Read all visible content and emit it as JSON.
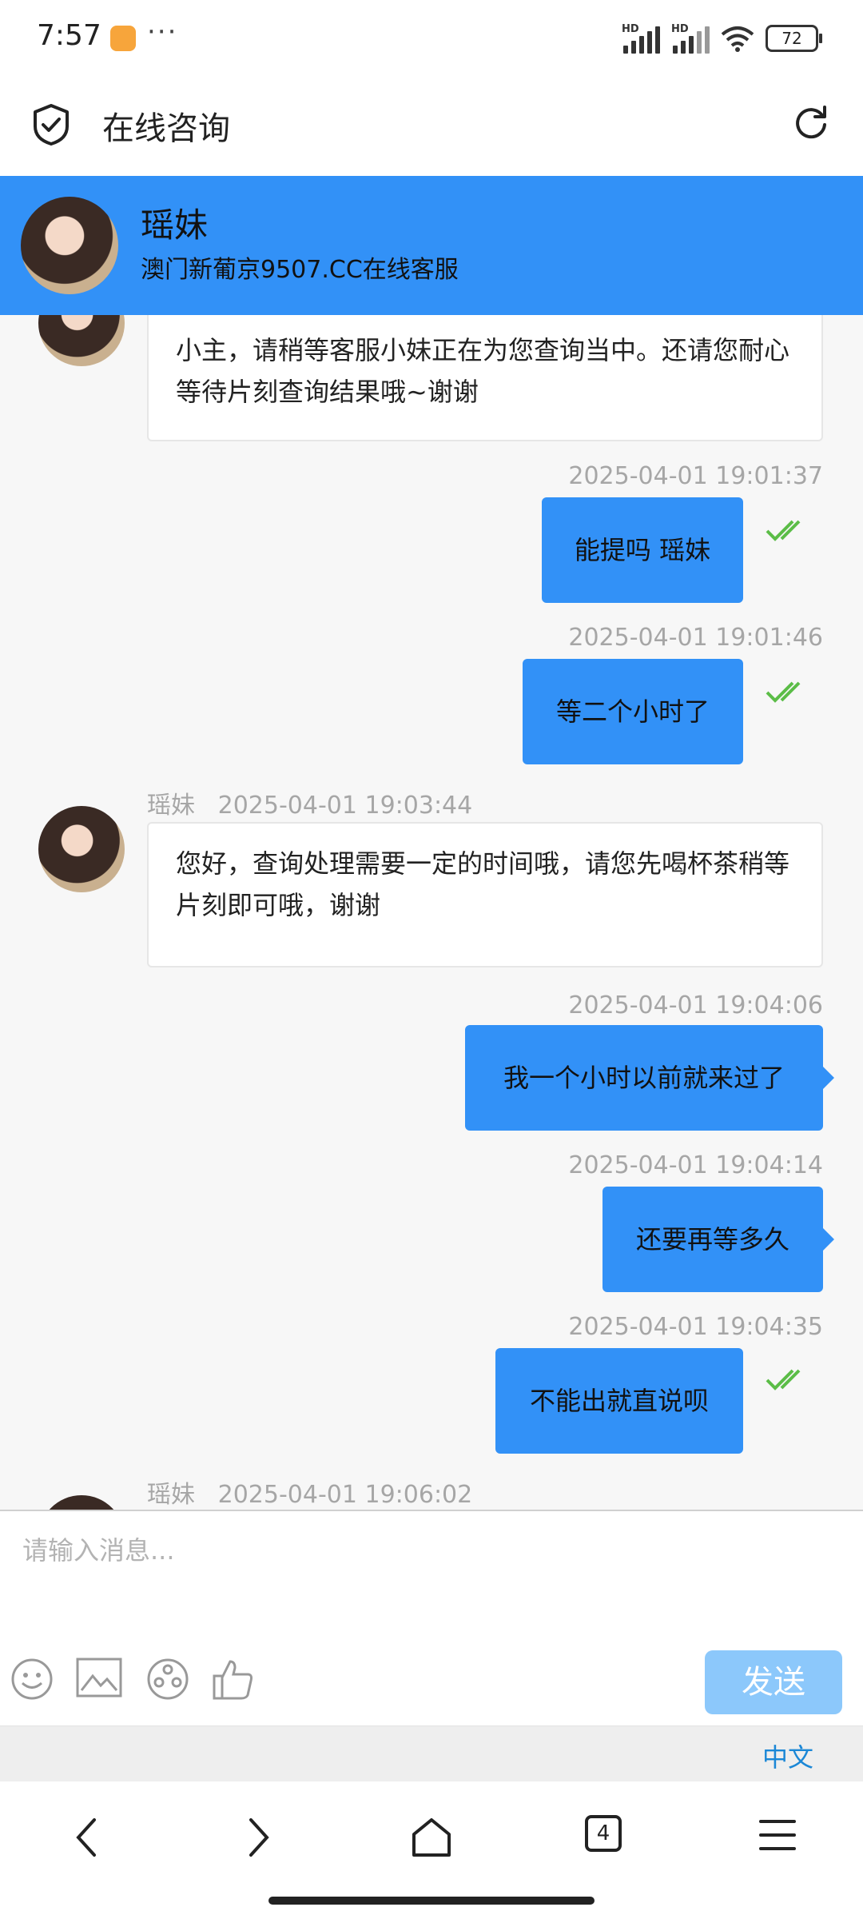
{
  "status_bar": {
    "time": "7:57",
    "more": "···",
    "signal1_label": "HD",
    "signal2_label": "HD",
    "battery": "72"
  },
  "header": {
    "title": "在线咨询",
    "left_icon": "shield-check-icon",
    "right_icon": "refresh-icon"
  },
  "agent": {
    "name": "瑶妹",
    "subtitle": "澳门新葡京9507.CC在线客服"
  },
  "messages": [
    {
      "side": "left",
      "sender": "",
      "time": "",
      "text": "小主，请稍等客服小妹正在为您查询当中。还请您耐心等待片刻查询结果哦~谢谢"
    },
    {
      "side": "right",
      "time": "2025-04-01 19:01:37",
      "text": "能提吗 瑶妹",
      "read": true
    },
    {
      "side": "right",
      "time": "2025-04-01 19:01:46",
      "text": "等二个小时了",
      "read": true
    },
    {
      "side": "left",
      "sender": "瑶妹",
      "time": "2025-04-01 19:03:44",
      "text": "您好，查询处理需要一定的时间哦，请您先喝杯茶稍等片刻即可哦，谢谢"
    },
    {
      "side": "right",
      "time": "2025-04-01 19:04:06",
      "text": "我一个小时以前就来过了",
      "read": false
    },
    {
      "side": "right",
      "time": "2025-04-01 19:04:14",
      "text": "还要再等多久",
      "read": false
    },
    {
      "side": "right",
      "time": "2025-04-01 19:04:35",
      "text": "不能出就直说呗",
      "read": true
    },
    {
      "side": "left",
      "sender": "瑶妹",
      "time": "2025-04-01 19:06:02",
      "text": ""
    }
  ],
  "composer": {
    "placeholder": "请输入消息...",
    "send_label": "发送",
    "tools": [
      "emoji-icon",
      "image-icon",
      "video-icon",
      "thumbs-up-icon"
    ]
  },
  "language": "中文",
  "nav": {
    "tab_count": "4",
    "items": [
      "back-icon",
      "forward-icon",
      "home-icon",
      "tabs-icon",
      "menu-icon"
    ]
  },
  "colors": {
    "accent": "#3291f7",
    "send_disabled": "#8cc8fb",
    "read_check": "#5bbd47",
    "language_link": "#1b87d6"
  }
}
